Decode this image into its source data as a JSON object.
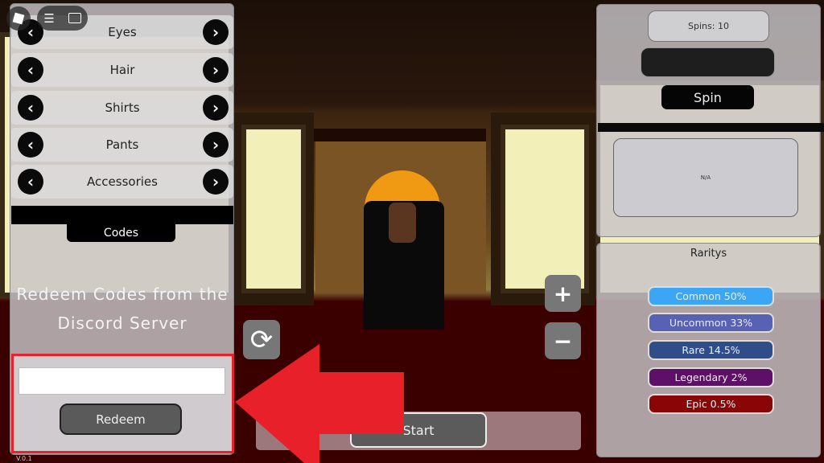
{
  "topbar": {
    "menu_icon": "hamburger-icon",
    "chat_icon": "chat-icon",
    "logo_icon": "roblox-logo-icon"
  },
  "customize": {
    "categories": [
      {
        "label": "Eyes"
      },
      {
        "label": "Hair"
      },
      {
        "label": "Shirts"
      },
      {
        "label": "Pants"
      },
      {
        "label": "Accessories"
      }
    ]
  },
  "codes": {
    "tab_label": "Codes",
    "message": "Redeem Codes from the Discord Server",
    "input_value": "",
    "redeem_label": "Redeem",
    "highlight_color": "#e8222a"
  },
  "version": "V.0.1",
  "controls": {
    "start_label": "Start",
    "zoom_in": "+",
    "zoom_out": "−",
    "rotate_icon": "rotate-icon"
  },
  "spin": {
    "spins_label": "Spins: 10",
    "result_value": "",
    "spin_label": "Spin",
    "preview_text": "N/A"
  },
  "rarities": {
    "title": "Raritys",
    "items": [
      {
        "label": "Common 50%",
        "color": "#3aa6f5"
      },
      {
        "label": "Uncommon 33%",
        "color": "#5862b4"
      },
      {
        "label": "Rare 14.5%",
        "color": "#2e4d8a"
      },
      {
        "label": "Legendary 2%",
        "color": "#5e1068"
      },
      {
        "label": "Epic 0.5%",
        "color": "#8a0606"
      }
    ]
  }
}
